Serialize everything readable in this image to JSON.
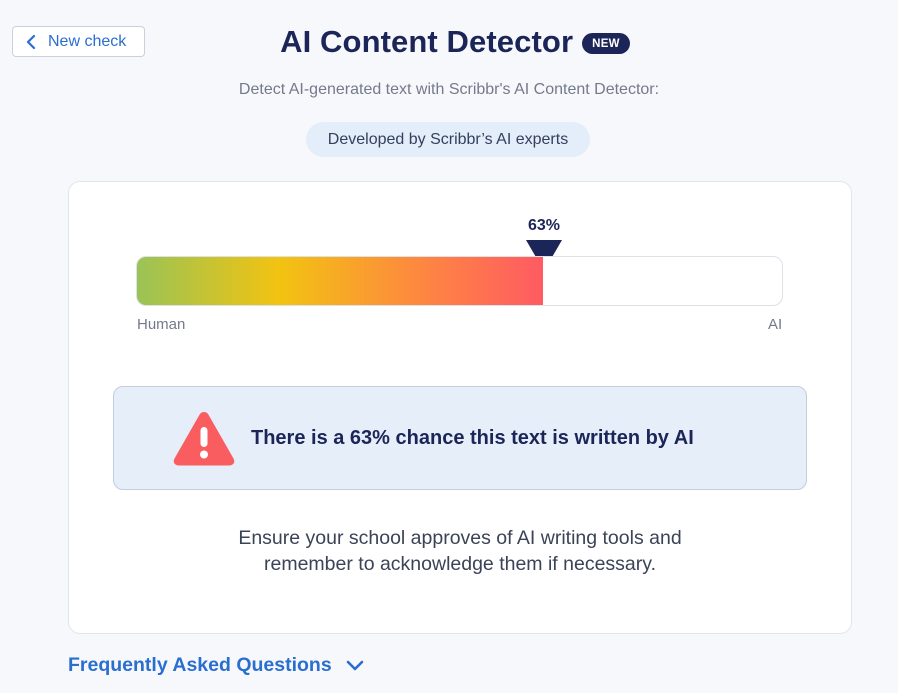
{
  "header": {
    "back_button_label": "New check",
    "title": "AI Content Detector",
    "badge": "NEW",
    "subtitle": "Detect AI-generated text with Scribbr's AI Content Detector:",
    "developed_by": "Developed by Scribbr’s AI experts"
  },
  "meter": {
    "percent_label": "63%",
    "value": 0.63,
    "left_label": "Human",
    "right_label": "AI"
  },
  "result": {
    "icon": "warning-triangle-icon",
    "message": "There is a 63% chance this text is written by AI"
  },
  "advice": {
    "line1": "Ensure your school approves of AI writing tools and",
    "line2": "remember to acknowledge them if necessary."
  },
  "faq": {
    "label": "Frequently Asked Questions"
  },
  "colors": {
    "navy": "#1c2558",
    "link_blue": "#2a6ed0",
    "alert_red": "#fa5d5f",
    "gradient_green": "#9ac356",
    "gradient_yellow": "#f2c311",
    "gradient_orange": "#fd8a3e",
    "gradient_red": "#ff5b62"
  }
}
